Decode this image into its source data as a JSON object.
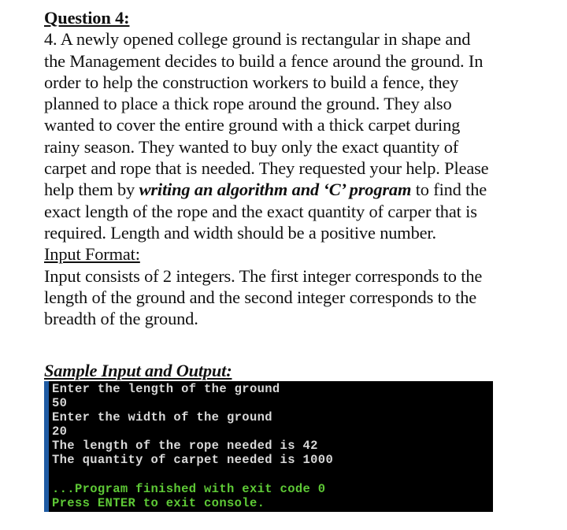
{
  "question": {
    "heading": "Question 4:",
    "body_lines": [
      "4. A newly opened college ground is rectangular in shape and",
      "the Management decides to build a fence around the ground. In",
      "order to help the construction workers to build a fence, they",
      "planned to place a thick rope around the ground. They also",
      "wanted to cover the entire ground with a thick carpet during",
      "rainy season. They wanted to buy only the exact quantity of",
      "carpet and rope that is needed. They requested your help. Please"
    ],
    "emph_line": {
      "before": "help them by ",
      "emphasis": "writing an algorithm and ‘C’ program",
      "after": " to find the"
    },
    "body_lines_2": [
      "exact length of the rope and the exact quantity of carper that is",
      "required. Length and width should be a positive number."
    ],
    "input_format_heading": "Input Format:",
    "input_format_lines": [
      "Input consists of 2 integers. The first integer corresponds to the",
      "length of the ground and the second integer corresponds to the",
      "breadth of the ground."
    ],
    "sample_heading": "Sample Input and Output:"
  },
  "terminal": {
    "colors": {
      "background": "#000000",
      "border": "#1f5ba3",
      "text": "#d9d9d9",
      "status": "#5ec936"
    },
    "lines": [
      {
        "text": "Enter the length of the ground",
        "kind": "out"
      },
      {
        "text": "50",
        "kind": "out"
      },
      {
        "text": "Enter the width of the ground",
        "kind": "out"
      },
      {
        "text": "20",
        "kind": "out"
      },
      {
        "text": "The length of the rope needed is 42",
        "kind": "out"
      },
      {
        "text": "The quantity of carpet needed is 1000",
        "kind": "out"
      },
      {
        "text": "",
        "kind": "blank"
      },
      {
        "text": "...Program finished with exit code 0",
        "kind": "green"
      },
      {
        "text": "Press ENTER to exit console.",
        "kind": "green"
      }
    ]
  }
}
